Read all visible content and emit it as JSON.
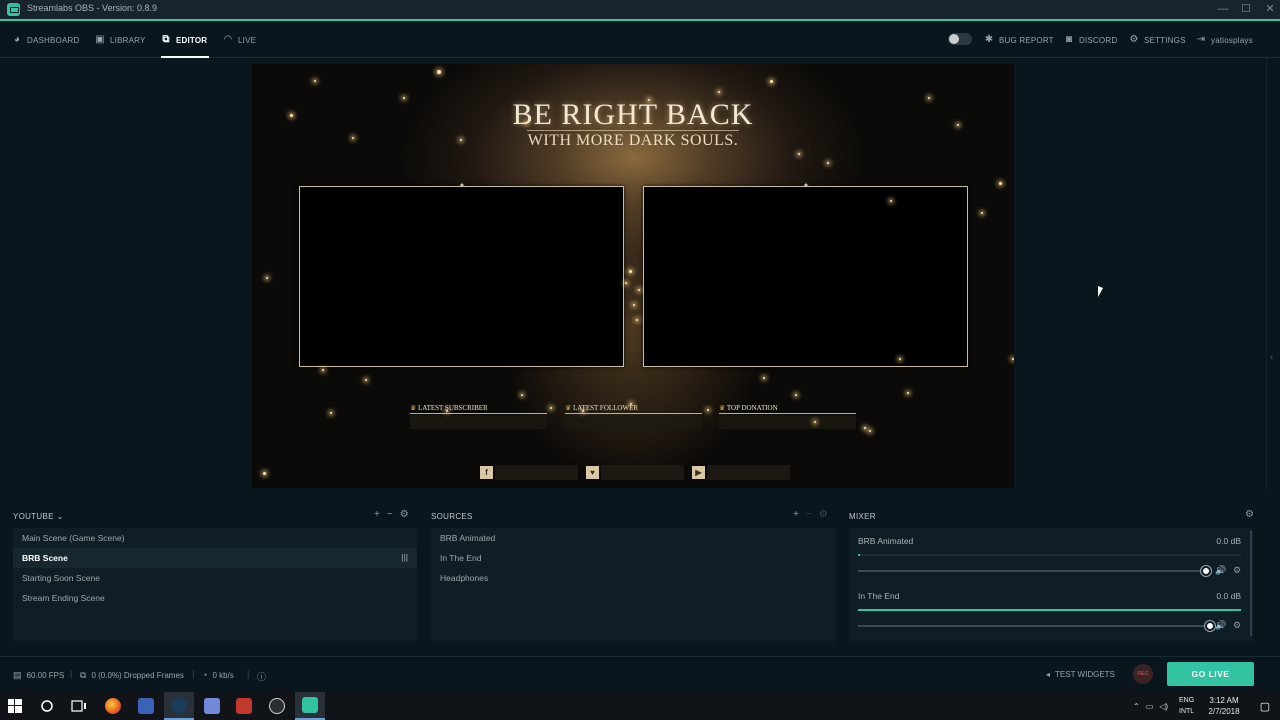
{
  "window": {
    "title": "Streamlabs OBS - Version: 0.8.9",
    "controls": {
      "minimize": "—",
      "maximize": "☐",
      "close": "✕"
    }
  },
  "nav": {
    "left": [
      {
        "label": "DASHBOARD",
        "icon": "dashboard-icon",
        "glyph": "◕"
      },
      {
        "label": "LIBRARY",
        "icon": "image-icon",
        "glyph": "▣"
      },
      {
        "label": "EDITOR",
        "icon": "editor-icon",
        "glyph": "⧉"
      },
      {
        "label": "LIVE",
        "icon": "rss-icon",
        "glyph": "◠"
      }
    ],
    "active": "EDITOR",
    "right": [
      {
        "label": "BUG REPORT",
        "icon": "bug-icon",
        "glyph": "✱"
      },
      {
        "label": "DISCORD",
        "icon": "discord-icon",
        "glyph": "◙"
      },
      {
        "label": "SETTINGS",
        "icon": "gear-icon",
        "glyph": "⚙"
      },
      {
        "label": "yatiosplays",
        "icon": "logout-icon",
        "glyph": "⇥"
      }
    ]
  },
  "preview": {
    "title": "BE RIGHT BACK",
    "subtitle": "WITH MORE DARK SOULS.",
    "tickers": [
      "LATEST SUBSCRIBER",
      "LATEST FOLLOWER",
      "TOP DONATION"
    ],
    "social_icons": [
      "f",
      "♥",
      "▶"
    ]
  },
  "scenes": {
    "header": "YOUTUBE",
    "tools": [
      "+",
      "−",
      "⚙"
    ],
    "items": [
      "Main Scene (Game Scene)",
      "BRB Scene",
      "Starting Soon Scene",
      "Stream Ending Scene"
    ],
    "selected": "BRB Scene",
    "grip": "|||"
  },
  "sources": {
    "header": "SOURCES",
    "tools": [
      "+",
      "−",
      "⚙"
    ],
    "items": [
      "BRB Animated",
      "In The End",
      "Headphones"
    ]
  },
  "mixer": {
    "header": "MIXER",
    "tool": "⚙",
    "items": [
      {
        "name": "BRB Animated",
        "db": "0.0 dB",
        "meter_level": 0.005,
        "volume": 1.0
      },
      {
        "name": "In The End",
        "db": "0.0 dB",
        "meter_level": 1.0,
        "volume": 1.0
      }
    ],
    "volume_glyph": "🔊",
    "settings_glyph": "⚙"
  },
  "footer": {
    "fps": "60.00 FPS",
    "dropped": "0 (0.0%) Dropped Frames",
    "bitrate": "0 kb/s",
    "test_widgets": "TEST WIDGETS",
    "rec": "REC",
    "go_live": "GO LIVE"
  },
  "taskbar": {
    "lang": "ENG",
    "lang2": "INTL",
    "time": "3:12 AM",
    "date": "2/7/2018"
  },
  "colors": {
    "accent": "#31c3a2",
    "background": "#09161d",
    "panel": "#0f1e26"
  }
}
